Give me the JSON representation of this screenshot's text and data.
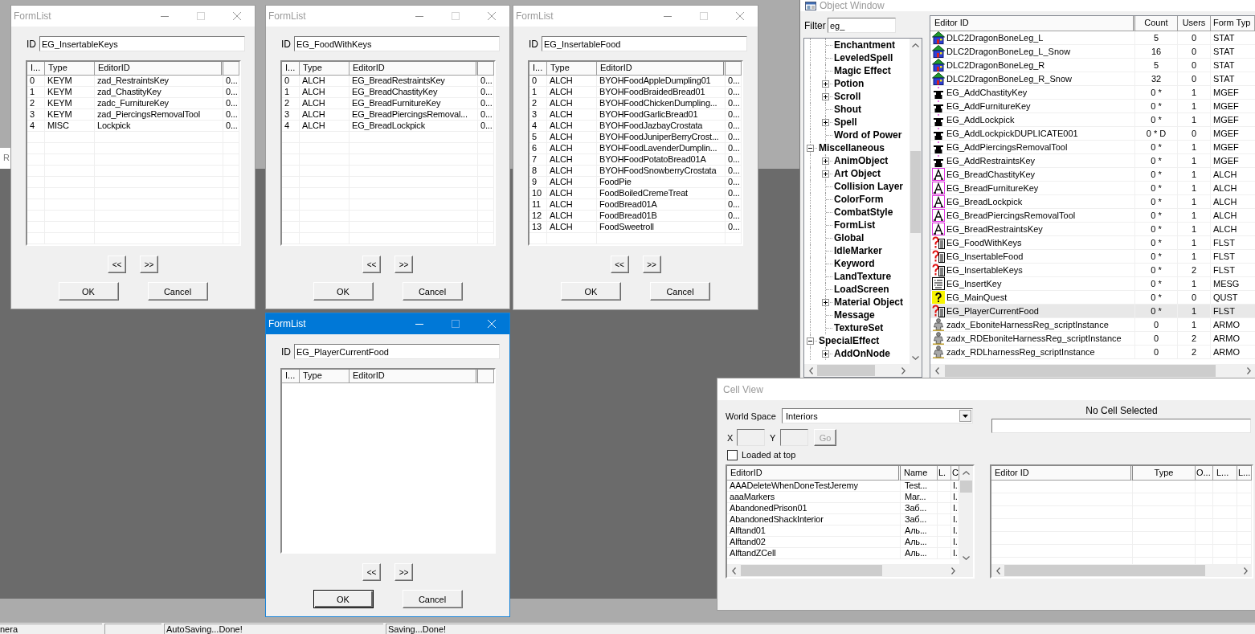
{
  "background_panel": {
    "text": "R"
  },
  "formlists": [
    {
      "title": "FormList",
      "active": false,
      "id_label": "ID",
      "id_value": "EG_InsertableKeys",
      "columns": [
        "I...",
        "Type",
        "EditorID"
      ],
      "rows": [
        {
          "index": "0",
          "type": "KEYM",
          "editor_id": "zad_RestraintsKey",
          "column_4": "0..."
        },
        {
          "index": "1",
          "type": "KEYM",
          "editor_id": "zad_ChastityKey",
          "column_4": "0..."
        },
        {
          "index": "2",
          "type": "KEYM",
          "editor_id": "zadc_FurnitureKey",
          "column_4": "0..."
        },
        {
          "index": "3",
          "type": "KEYM",
          "editor_id": "zad_PiercingsRemovalTool",
          "column_4": "0..."
        },
        {
          "index": "4",
          "type": "MISC",
          "editor_id": "Lockpick",
          "column_4": "0..."
        }
      ],
      "buttons": {
        "previous": "<<",
        "next": ">>",
        "ok": "OK",
        "cancel": "Cancel"
      }
    },
    {
      "title": "FormList",
      "active": false,
      "id_label": "ID",
      "id_value": "EG_FoodWithKeys",
      "columns": [
        "I...",
        "Type",
        "EditorID"
      ],
      "rows": [
        {
          "index": "0",
          "type": "ALCH",
          "editor_id": "EG_BreadRestraintsKey",
          "column_4": "0..."
        },
        {
          "index": "1",
          "type": "ALCH",
          "editor_id": "EG_BreadChastityKey",
          "column_4": "0..."
        },
        {
          "index": "2",
          "type": "ALCH",
          "editor_id": "EG_BreadFurnitureKey",
          "column_4": "0..."
        },
        {
          "index": "3",
          "type": "ALCH",
          "editor_id": "EG_BreadPiercingsRemoval...",
          "column_4": "0..."
        },
        {
          "index": "4",
          "type": "ALCH",
          "editor_id": "EG_BreadLockpick",
          "column_4": "0..."
        }
      ],
      "buttons": {
        "previous": "<<",
        "next": ">>",
        "ok": "OK",
        "cancel": "Cancel"
      }
    },
    {
      "title": "FormList",
      "active": false,
      "id_label": "ID",
      "id_value": "EG_InsertableFood",
      "columns": [
        "I...",
        "Type",
        "EditorID"
      ],
      "rows": [
        {
          "index": "0",
          "type": "ALCH",
          "editor_id": "BYOHFoodAppleDumpling01",
          "column_4": "0..."
        },
        {
          "index": "1",
          "type": "ALCH",
          "editor_id": "BYOHFoodBraidedBread01",
          "column_4": "0..."
        },
        {
          "index": "2",
          "type": "ALCH",
          "editor_id": "BYOHFoodChickenDumpling...",
          "column_4": "0..."
        },
        {
          "index": "3",
          "type": "ALCH",
          "editor_id": "BYOHFoodGarlicBread01",
          "column_4": "0..."
        },
        {
          "index": "4",
          "type": "ALCH",
          "editor_id": "BYOHFoodJazbayCrostata",
          "column_4": "0..."
        },
        {
          "index": "5",
          "type": "ALCH",
          "editor_id": "BYOHFoodJuniperBerryCrost...",
          "column_4": "0..."
        },
        {
          "index": "6",
          "type": "ALCH",
          "editor_id": "BYOHFoodLavenderDumplin...",
          "column_4": "0..."
        },
        {
          "index": "7",
          "type": "ALCH",
          "editor_id": "BYOHFoodPotatoBread01A",
          "column_4": "0..."
        },
        {
          "index": "8",
          "type": "ALCH",
          "editor_id": "BYOHFoodSnowberryCrostata",
          "column_4": "0..."
        },
        {
          "index": "9",
          "type": "ALCH",
          "editor_id": "FoodPie",
          "column_4": "0..."
        },
        {
          "index": "10",
          "type": "ALCH",
          "editor_id": "FoodBoiledCremeTreat",
          "column_4": "0..."
        },
        {
          "index": "11",
          "type": "ALCH",
          "editor_id": "FoodBread01A",
          "column_4": "0..."
        },
        {
          "index": "12",
          "type": "ALCH",
          "editor_id": "FoodBread01B",
          "column_4": "0..."
        },
        {
          "index": "13",
          "type": "ALCH",
          "editor_id": "FoodSweetroll",
          "column_4": "0..."
        }
      ],
      "buttons": {
        "previous": "<<",
        "next": ">>",
        "ok": "OK",
        "cancel": "Cancel"
      }
    },
    {
      "title": "FormList",
      "active": true,
      "id_label": "ID",
      "id_value": "EG_PlayerCurrentFood",
      "columns": [
        "I...",
        "Type",
        "EditorID"
      ],
      "buttons": {
        "previous": "<<",
        "next": ">>",
        "ok": "OK",
        "cancel": "Cancel"
      }
    }
  ],
  "object_window": {
    "title": "Object Window",
    "active": false,
    "filter": {
      "label": "Filter",
      "value": "eg_"
    },
    "tree": [
      {
        "children": [
          {
            "label": "Enchantment"
          },
          {
            "label": "LeveledSpell"
          },
          {
            "label": "Magic Effect"
          },
          {
            "label": "Potion",
            "expanded": false
          },
          {
            "label": "Scroll",
            "expanded": false
          },
          {
            "label": "Shout"
          },
          {
            "label": "Spell",
            "expanded": false
          },
          {
            "label": "Word of Power"
          }
        ]
      },
      {
        "label": "Miscellaneous",
        "expanded": true,
        "children": [
          {
            "label": "AnimObject",
            "expanded": false
          },
          {
            "label": "Art Object",
            "expanded": false
          },
          {
            "label": "Collision Layer"
          },
          {
            "label": "ColorForm"
          },
          {
            "label": "CombatStyle"
          },
          {
            "label": "FormList"
          },
          {
            "label": "Global"
          },
          {
            "label": "IdleMarker"
          },
          {
            "label": "Keyword"
          },
          {
            "label": "LandTexture"
          },
          {
            "label": "LoadScreen"
          },
          {
            "label": "Material Object",
            "expanded": false
          },
          {
            "label": "Message"
          },
          {
            "label": "TextureSet"
          }
        ]
      },
      {
        "label": "SpecialEffect",
        "expanded": true,
        "children": [
          {
            "label": "AddOnNode",
            "expanded": false
          }
        ]
      }
    ],
    "columns": [
      "Editor ID",
      "Count",
      "Users",
      "Form Typ"
    ],
    "rows": [
      {
        "kind": "stat",
        "editor_id": "DLC2DragonBoneLeg_L",
        "count": "5",
        "users": "0",
        "form_type": "STAT",
        "selected": false
      },
      {
        "kind": "stat",
        "editor_id": "DLC2DragonBoneLeg_L_Snow",
        "count": "16",
        "users": "0",
        "form_type": "STAT",
        "selected": false
      },
      {
        "kind": "stat",
        "editor_id": "DLC2DragonBoneLeg_R",
        "count": "5",
        "users": "0",
        "form_type": "STAT",
        "selected": false
      },
      {
        "kind": "stat",
        "editor_id": "DLC2DragonBoneLeg_R_Snow",
        "count": "32",
        "users": "0",
        "form_type": "STAT",
        "selected": false
      },
      {
        "kind": "mgef",
        "editor_id": "EG_AddChastityKey",
        "count": "0 *",
        "users": "1",
        "form_type": "MGEF",
        "selected": false
      },
      {
        "kind": "mgef",
        "editor_id": "EG_AddFurnitureKey",
        "count": "0 *",
        "users": "1",
        "form_type": "MGEF",
        "selected": false
      },
      {
        "kind": "mgef",
        "editor_id": "EG_AddLockpick",
        "count": "0 *",
        "users": "1",
        "form_type": "MGEF",
        "selected": false
      },
      {
        "kind": "mgef",
        "editor_id": "EG_AddLockpickDUPLICATE001",
        "count": "0 * D",
        "users": "0",
        "form_type": "MGEF",
        "selected": false
      },
      {
        "kind": "mgef",
        "editor_id": "EG_AddPiercingsRemovalTool",
        "count": "0 *",
        "users": "1",
        "form_type": "MGEF",
        "selected": false
      },
      {
        "kind": "mgef",
        "editor_id": "EG_AddRestraintsKey",
        "count": "0 *",
        "users": "1",
        "form_type": "MGEF",
        "selected": false
      },
      {
        "kind": "alch",
        "editor_id": "EG_BreadChastityKey",
        "count": "0 *",
        "users": "1",
        "form_type": "ALCH",
        "selected": false
      },
      {
        "kind": "alch",
        "editor_id": "EG_BreadFurnitureKey",
        "count": "0 *",
        "users": "1",
        "form_type": "ALCH",
        "selected": false
      },
      {
        "kind": "alch",
        "editor_id": "EG_BreadLockpick",
        "count": "0 *",
        "users": "1",
        "form_type": "ALCH",
        "selected": false
      },
      {
        "kind": "alch",
        "editor_id": "EG_BreadPiercingsRemovalTool",
        "count": "0 *",
        "users": "1",
        "form_type": "ALCH",
        "selected": false
      },
      {
        "kind": "alch",
        "editor_id": "EG_BreadRestraintsKey",
        "count": "0 *",
        "users": "1",
        "form_type": "ALCH",
        "selected": false
      },
      {
        "kind": "flst",
        "editor_id": "EG_FoodWithKeys",
        "count": "0 *",
        "users": "1",
        "form_type": "FLST",
        "selected": false
      },
      {
        "kind": "flst",
        "editor_id": "EG_InsertableFood",
        "count": "0 *",
        "users": "1",
        "form_type": "FLST",
        "selected": false
      },
      {
        "kind": "flst",
        "editor_id": "EG_InsertableKeys",
        "count": "0 *",
        "users": "2",
        "form_type": "FLST",
        "selected": false
      },
      {
        "kind": "mesg",
        "editor_id": "EG_InsertKey",
        "count": "0 *",
        "users": "1",
        "form_type": "MESG",
        "selected": false
      },
      {
        "kind": "qust",
        "editor_id": "EG_MainQuest",
        "count": "0 *",
        "users": "0",
        "form_type": "QUST",
        "selected": false
      },
      {
        "kind": "flst",
        "editor_id": "EG_PlayerCurrentFood",
        "count": "0 *",
        "users": "1",
        "form_type": "FLST",
        "selected": true
      },
      {
        "kind": "armo",
        "editor_id": "zadx_EboniteHarnessReg_scriptInstance",
        "count": "0",
        "users": "1",
        "form_type": "ARMO",
        "selected": false
      },
      {
        "kind": "armo",
        "editor_id": "zadx_RDEboniteHarnessReg_scriptInstance",
        "count": "0",
        "users": "2",
        "form_type": "ARMO",
        "selected": false
      },
      {
        "kind": "armo",
        "editor_id": "zadx_RDLharnessReg_scriptInstance",
        "count": "0",
        "users": "2",
        "form_type": "ARMO",
        "selected": false
      }
    ]
  },
  "cell_view": {
    "title": "Cell View",
    "active": false,
    "world_space": {
      "label": "World Space",
      "value": "Interiors"
    },
    "x_field": {
      "label": "X",
      "disabled": true
    },
    "y_field": {
      "label": "Y",
      "disabled": true
    },
    "go_button": {
      "label": "Go",
      "disabled": true
    },
    "loaded_at_top": {
      "label": "Loaded at top",
      "checked": false
    },
    "cell_label": "No Cell Selected",
    "cell_list": {
      "columns": [
        "EditorID",
        "Name",
        "L.",
        "C"
      ],
      "rows": [
        {
          "editor_id": "AAADeleteWhenDoneTestJeremy",
          "name": "Test...",
          "column_4": "I."
        },
        {
          "editor_id": "aaaMarkers",
          "name": "Mar...",
          "column_4": "I."
        },
        {
          "editor_id": "AbandonedPrison01",
          "name": "Заб...",
          "column_4": "I."
        },
        {
          "editor_id": "AbandonedShackInterior",
          "name": "Заб...",
          "column_4": "I."
        },
        {
          "editor_id": "Alftand01",
          "name": "Аль...",
          "column_4": "I."
        },
        {
          "editor_id": "Alftand02",
          "name": "Аль...",
          "column_4": "I."
        },
        {
          "editor_id": "AlftandZCell",
          "name": "Аль...",
          "column_4": "I."
        }
      ]
    },
    "object_list": {
      "columns": [
        "Editor ID",
        "Type",
        "O...",
        "L...",
        "L..."
      ]
    }
  },
  "status_bar": {
    "segments": [
      "nera",
      "AutoSaving...Done!",
      "Saving...Done!"
    ]
  }
}
